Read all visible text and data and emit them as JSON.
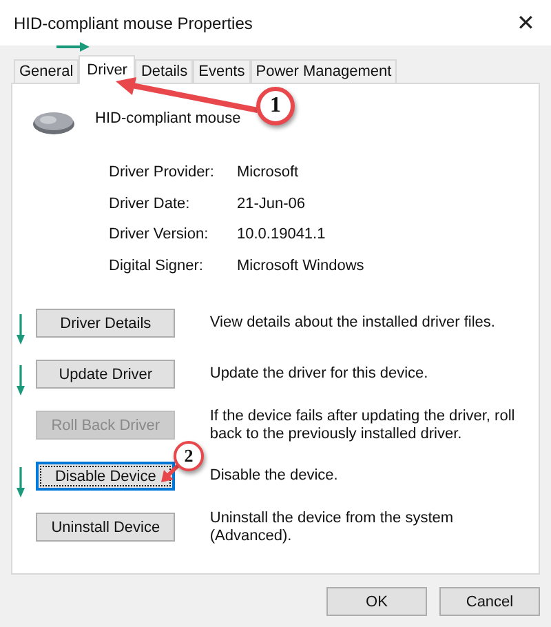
{
  "window": {
    "title": "HID-compliant mouse Properties",
    "close": "✕"
  },
  "tabs": [
    {
      "label": "General",
      "selected": false
    },
    {
      "label": "Driver",
      "selected": true
    },
    {
      "label": "Details",
      "selected": false
    },
    {
      "label": "Events",
      "selected": false
    },
    {
      "label": "Power Management",
      "selected": false
    }
  ],
  "device": {
    "name": "HID-compliant mouse"
  },
  "properties": [
    {
      "label": "Driver Provider:",
      "value": "Microsoft"
    },
    {
      "label": "Driver Date:",
      "value": "21-Jun-06"
    },
    {
      "label": "Driver Version:",
      "value": "10.0.19041.1"
    },
    {
      "label": "Digital Signer:",
      "value": "Microsoft Windows"
    }
  ],
  "actions": [
    {
      "label": "Driver Details",
      "description": "View details about the installed driver files.",
      "disabled": false,
      "focused": false,
      "marked": true
    },
    {
      "label": "Update Driver",
      "description": "Update the driver for this device.",
      "disabled": false,
      "focused": false,
      "marked": true
    },
    {
      "label": "Roll Back Driver",
      "description": "If the device fails after updating the driver, roll back to the previously installed driver.",
      "disabled": true,
      "focused": false,
      "marked": false
    },
    {
      "label": "Disable Device",
      "description": "Disable the device.",
      "disabled": false,
      "focused": true,
      "marked": true
    },
    {
      "label": "Uninstall Device",
      "description": "Uninstall the device from the system (Advanced).",
      "disabled": false,
      "focused": false,
      "marked": false
    }
  ],
  "callouts": [
    {
      "number": "1"
    },
    {
      "number": "2"
    }
  ],
  "buttons": [
    "OK",
    "Cancel"
  ]
}
